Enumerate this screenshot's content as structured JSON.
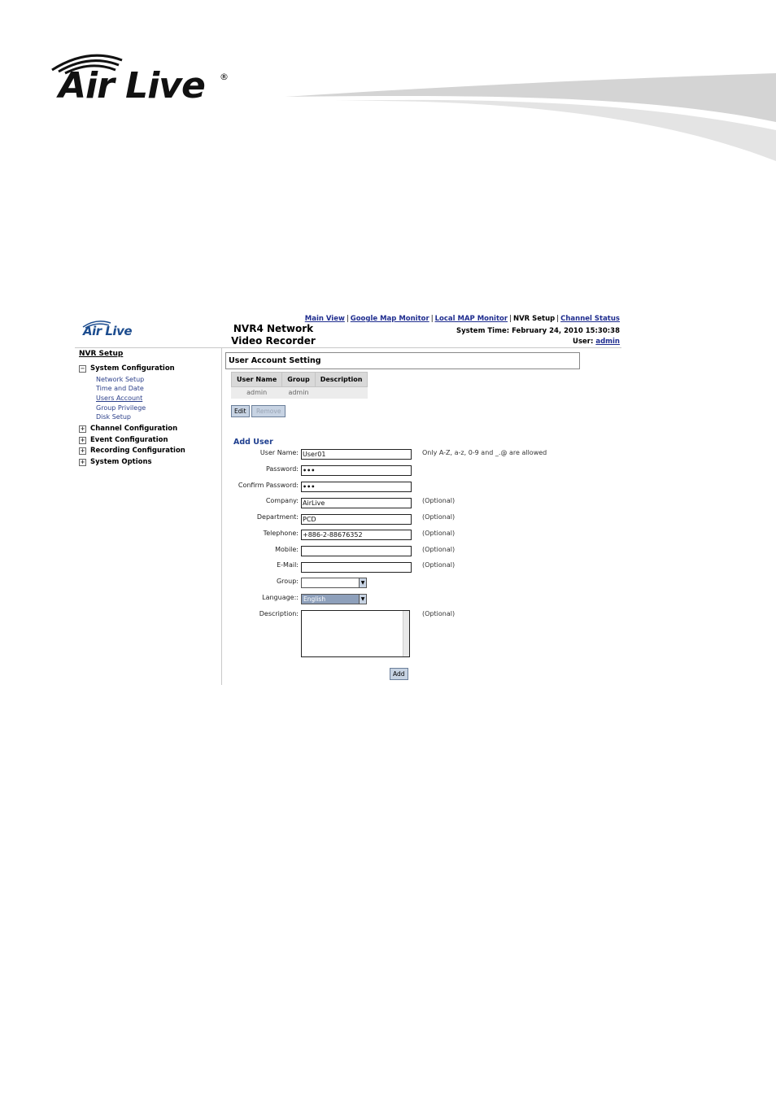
{
  "brand": {
    "wordmark": "Air Live",
    "registered": "®"
  },
  "screenshot": {
    "logo_text": "Air Live",
    "app_title_line1": "NVR4 Network",
    "app_title_line2": "Video Recorder",
    "topnav": {
      "main_view": "Main View",
      "google_map": "Google Map Monitor",
      "local_map": "Local MAP Monitor",
      "nvr_setup": "NVR Setup",
      "channel_status": "Channel Status",
      "separator": "|"
    },
    "system_time_label": "System Time:",
    "system_time_value": "February 24, 2010 15:30:38",
    "user_label": "User:",
    "user_value": "admin",
    "sidebar": {
      "title": "NVR Setup",
      "groups": [
        {
          "label": "System Configuration",
          "toggle": "−"
        },
        {
          "label": "Channel Configuration",
          "toggle": "+"
        },
        {
          "label": "Event Configuration",
          "toggle": "+"
        },
        {
          "label": "Recording Configuration",
          "toggle": "+"
        },
        {
          "label": "System Options",
          "toggle": "+"
        }
      ],
      "sub_items": [
        "Network Setup",
        "Time and Date",
        "Users Account",
        "Group Privilege",
        "Disk Setup"
      ]
    },
    "panel_title": "User Account Setting",
    "table": {
      "headers": [
        "User Name",
        "Group",
        "Description"
      ],
      "rows": [
        [
          "admin",
          "admin",
          ""
        ]
      ]
    },
    "buttons": {
      "edit": "Edit",
      "remove": "Remove",
      "add": "Add"
    },
    "add_user": {
      "title": "Add User",
      "fields": {
        "user_name": {
          "label": "User Name:",
          "value": "User01",
          "note": "Only A-Z, a-z, 0-9 and _.@ are allowed"
        },
        "password": {
          "label": "Password:",
          "value": "•••"
        },
        "confirm_password": {
          "label": "Confirm Password:",
          "value": "•••"
        },
        "company": {
          "label": "Company:",
          "value": "AirLive",
          "note": "(Optional)"
        },
        "department": {
          "label": "Department:",
          "value": "PCD",
          "note": "(Optional)"
        },
        "telephone": {
          "label": "Telephone:",
          "value": "+886-2-88676352",
          "note": "(Optional)"
        },
        "mobile": {
          "label": "Mobile:",
          "value": "",
          "note": "(Optional)"
        },
        "email": {
          "label": "E-Mail:",
          "value": "",
          "note": "(Optional)"
        },
        "group": {
          "label": "Group:",
          "value": ""
        },
        "language": {
          "label": "Language::",
          "value": "English"
        },
        "description": {
          "label": "Description:",
          "note": "(Optional)"
        }
      }
    }
  }
}
